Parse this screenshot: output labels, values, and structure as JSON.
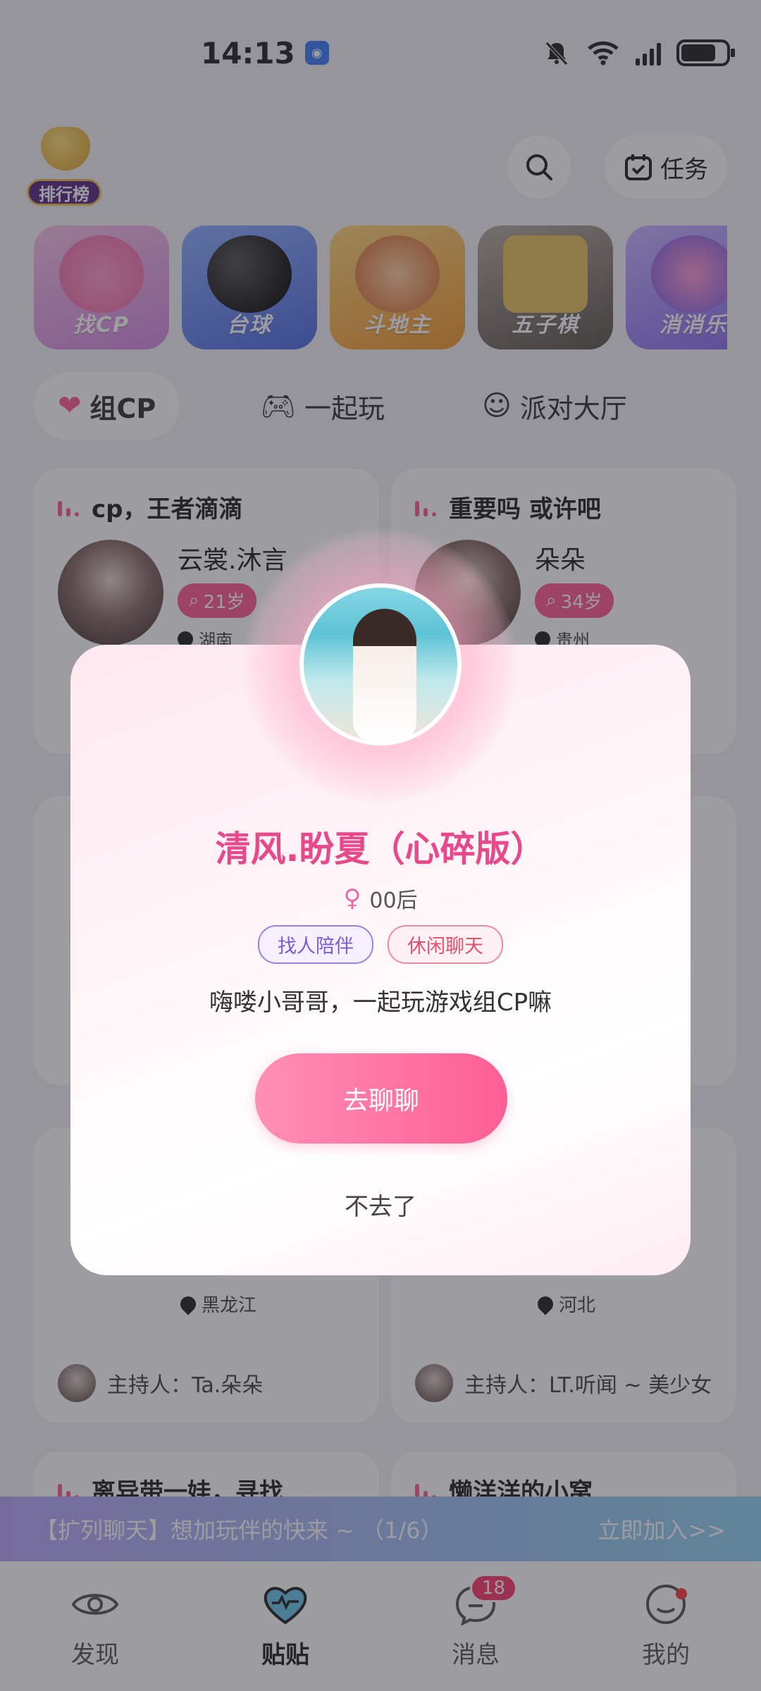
{
  "status_bar": {
    "time": "14:13",
    "network": "4G"
  },
  "header": {
    "rank_label": "排行榜",
    "task_label": "任务"
  },
  "games": [
    {
      "label": "找CP",
      "color": "#e8a2d9"
    },
    {
      "label": "台球",
      "color": "#6f8cf0"
    },
    {
      "label": "斗地主",
      "color": "#f5b649"
    },
    {
      "label": "五子棋",
      "color": "#7a7168"
    },
    {
      "label": "消消乐",
      "color": "#a58cf3"
    }
  ],
  "categories": [
    {
      "label": "组CP",
      "active": true
    },
    {
      "label": "一起玩",
      "active": false
    },
    {
      "label": "派对大厅",
      "active": false
    }
  ],
  "cards": [
    {
      "title": "cp，王者滴滴",
      "name": "云裳.沐言",
      "age": "21岁",
      "location": "湖南"
    },
    {
      "title": "重要吗 或许吧",
      "name": "朵朵",
      "age": "34岁",
      "location": "贵州"
    },
    {
      "location": "黑龙江",
      "host": "主持人：Ta.朵朵"
    },
    {
      "location": "河北",
      "host": "主持人：LT.听闻 ~ 美少女"
    },
    {
      "title": "离异带一娃，寻找"
    },
    {
      "title": "懒洋洋的小窝"
    }
  ],
  "banner": {
    "text": "【扩列聊天】想加玩伴的快来 ~ （1/6）",
    "join": "立即加入>>"
  },
  "nav": [
    {
      "label": "发现"
    },
    {
      "label": "贴贴",
      "active": true
    },
    {
      "label": "消息",
      "badge": "18"
    },
    {
      "label": "我的",
      "dot": true
    }
  ],
  "modal": {
    "name": "清风.盼夏（心碎版）",
    "gender_symbol": "♀",
    "generation": "00后",
    "tags": [
      "找人陪伴",
      "休闲聊天"
    ],
    "bio": "嗨喽小哥哥，一起玩游戏组CP嘛",
    "primary_button": "去聊聊",
    "secondary_button": "不去了"
  }
}
